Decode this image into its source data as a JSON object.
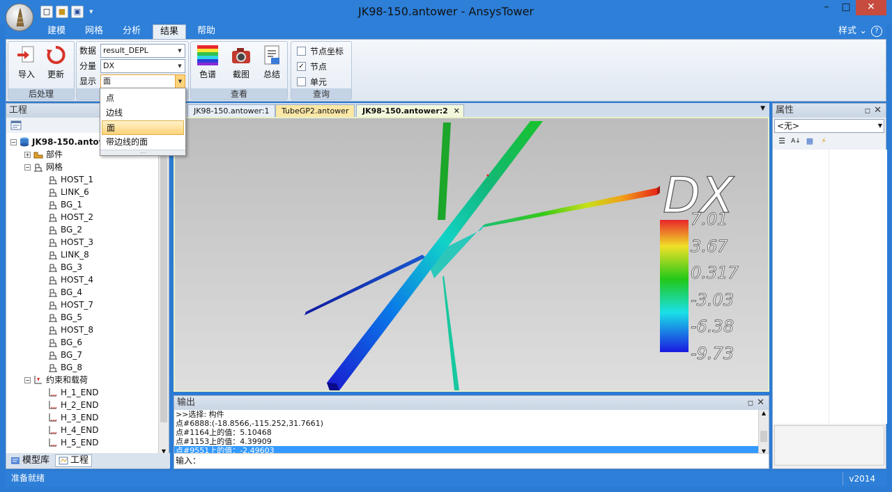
{
  "window": {
    "title": "JK98-150.antower - AnsysTower",
    "minimize": "–",
    "maximize": "□",
    "close": "✕"
  },
  "quick_access": [
    "new-file-icon",
    "open-folder-icon",
    "save-icon"
  ],
  "ribbon_tabs": [
    {
      "label": "建模"
    },
    {
      "label": "网格"
    },
    {
      "label": "分析"
    },
    {
      "label": "结果",
      "active": true
    },
    {
      "label": "帮助"
    }
  ],
  "style_menu": "样式",
  "ribbon": {
    "postprocess": {
      "title": "后处理",
      "import_label": "导入",
      "update_label": "更新"
    },
    "data_group": {
      "data_label": "数据",
      "data_value": "result_DEPL",
      "component_label": "分量",
      "component_value": "DX",
      "display_label": "显示",
      "display_value": "面"
    },
    "view": {
      "title": "查看",
      "spectrum_label": "色谱",
      "screenshot_label": "截图",
      "summary_label": "总结"
    },
    "query": {
      "title": "查询",
      "items": [
        {
          "label": "节点坐标",
          "checked": false
        },
        {
          "label": "节点",
          "checked": true
        },
        {
          "label": "单元",
          "checked": false
        }
      ]
    }
  },
  "display_dropdown": {
    "options": [
      "点",
      "边线",
      "面",
      "带边线的面"
    ],
    "selected": "面",
    "grip": "....."
  },
  "project_panel": {
    "title": "工程",
    "root": "JK98-150.antow",
    "folders": [
      "部件",
      "网格",
      "约束和载荷"
    ],
    "mesh_items": [
      "HOST_1",
      "LINK_6",
      "BG_1",
      "HOST_2",
      "BG_2",
      "HOST_3",
      "LINK_8",
      "BG_3",
      "HOST_4",
      "BG_4",
      "HOST_7",
      "BG_5",
      "HOST_8",
      "BG_6",
      "BG_7",
      "BG_8"
    ],
    "constraint_items": [
      "H_1_END",
      "H_2_END",
      "H_3_END",
      "H_4_END",
      "H_5_END"
    ],
    "bottom_tabs": [
      "模型库",
      "工程"
    ]
  },
  "doc_tabs": [
    {
      "label": "JK98-150.antower:1",
      "color": "#e7eef7"
    },
    {
      "label": "TubeGP2.antower",
      "color": "#fbe7a6"
    },
    {
      "label": "JK98-150.antower:2",
      "color": "#f3f7dc",
      "active": true
    }
  ],
  "doc_close": "✕",
  "legend": {
    "title": "DX",
    "values": [
      "7.01",
      "3.67",
      "0.317",
      "-3.03",
      "-6.38",
      "-9.73"
    ]
  },
  "output": {
    "title": "输出",
    "lines": [
      ">>选择: 构件",
      "点#6888:(-18.8566,-115.252,31.7661)",
      "点#1164上的值：5.10468",
      "点#1153上的值：4.39909",
      "点#9551上的值：-2.49603"
    ],
    "highlighted_index": 4,
    "input_label": "输入："
  },
  "properties": {
    "title": "属性",
    "combo_value": "<无>"
  },
  "status": {
    "text": "准备就绪",
    "version": "v2014"
  }
}
